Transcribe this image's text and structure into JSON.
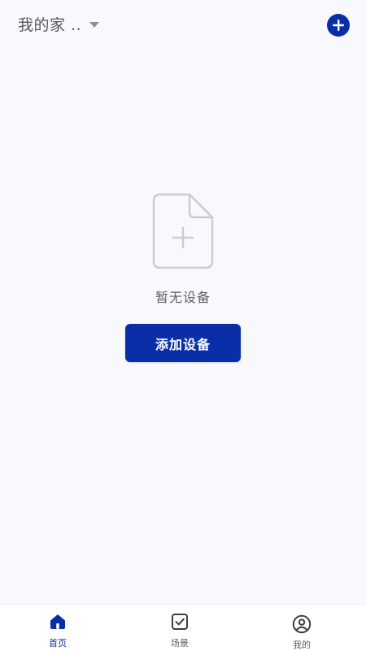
{
  "header": {
    "home_name": "我的家 ..",
    "add_icon": "plus-circle-icon"
  },
  "empty_state": {
    "icon": "file-add-icon",
    "text": "暂无设备",
    "button_label": "添加设备"
  },
  "tabbar": {
    "tabs": [
      {
        "label": "首页",
        "icon": "home-icon",
        "active": true
      },
      {
        "label": "场景",
        "icon": "checkbox-icon",
        "active": false
      },
      {
        "label": "我的",
        "icon": "user-circle-icon",
        "active": false
      }
    ]
  },
  "colors": {
    "accent": "#0a2ea8",
    "background": "#f7f9fc",
    "text_secondary": "#5b5f66",
    "icon_muted": "#c9ccd1",
    "tab_inactive": "#5c6066"
  }
}
